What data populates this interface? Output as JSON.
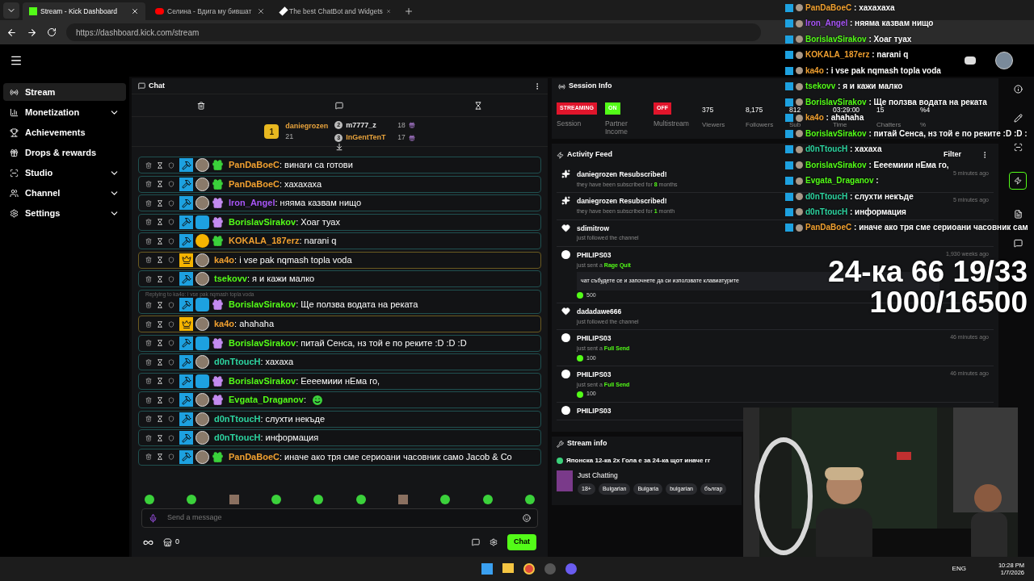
{
  "browser": {
    "tabs": [
      {
        "label": "Stream - Kick Dashboard",
        "selected": true,
        "kind": "kick"
      },
      {
        "label": "Селина - Вдига му бившат",
        "selected": false,
        "kind": "video"
      },
      {
        "label": "The best ChatBot and Widgets",
        "selected": false,
        "kind": "bot"
      }
    ],
    "url": "https://dashboard.kick.com/stream"
  },
  "sidebar": {
    "items": [
      {
        "label": "Stream",
        "selected": true,
        "expandable": false
      },
      {
        "label": "Monetization",
        "selected": false,
        "expandable": true
      },
      {
        "label": "Achievements",
        "selected": false,
        "expandable": false
      },
      {
        "label": "Drops & rewards",
        "selected": false,
        "expandable": false
      },
      {
        "label": "Studio",
        "selected": false,
        "expandable": true
      },
      {
        "label": "Channel",
        "selected": false,
        "expandable": true
      },
      {
        "label": "Settings",
        "selected": false,
        "expandable": true
      }
    ]
  },
  "chat": {
    "title": "Chat",
    "leaders": [
      {
        "rank": "1",
        "name": "daniegrozen",
        "count": "21",
        "color": "#e8a33c"
      },
      {
        "rank": "2",
        "name": "m7777_z",
        "count": "18",
        "color": "#e5e5e5"
      },
      {
        "rank": "3",
        "name": "InGentTenT",
        "count": "17",
        "color": "#e8a33c"
      }
    ],
    "messages": [
      {
        "user": "PanDaBoeC",
        "color": "#f0a030",
        "text": ": винаги са готови",
        "kind": "gifter",
        "highlight": false
      },
      {
        "user": "PanDaBoeC",
        "color": "#f0a030",
        "text": ": хахахаха",
        "kind": "gifter",
        "highlight": false
      },
      {
        "user": "Iron_Angel",
        "color": "#a855f7",
        "text": ": няяма казвам нищо",
        "kind": "purple",
        "highlight": false
      },
      {
        "user": "BorislavSirakov",
        "color": "#53fc18",
        "text": ": Хоаг туах",
        "kind": "og",
        "highlight": false
      },
      {
        "user": "KOKALA_187erz",
        "color": "#f0a030",
        "text": ": narani q",
        "kind": "rank",
        "highlight": false
      },
      {
        "user": "ka4o",
        "color": "#f0a030",
        "text": ": i vse pak nqmash topla voda",
        "kind": "vip",
        "highlight": true
      },
      {
        "user": "tsekovv",
        "color": "#53fc18",
        "text": ": я и кажи малко",
        "kind": "mod",
        "highlight": false
      },
      {
        "user": "BorislavSirakov",
        "color": "#53fc18",
        "text": ": Ще ползва водата на реката",
        "kind": "og",
        "highlight": false,
        "reply": "Replying to ka4o: i vse pak nqmash topla voda"
      },
      {
        "user": "ka4o",
        "color": "#f0a030",
        "text": ": ahahaha",
        "kind": "vip",
        "highlight": true
      },
      {
        "user": "BorislavSirakov",
        "color": "#53fc18",
        "text": ": питай Сенса, нз той е по реките :D :D :D",
        "kind": "og",
        "highlight": false
      },
      {
        "user": "d0nTtoucH",
        "color": "#2dd4a0",
        "text": ": хахаха",
        "kind": "mod",
        "highlight": false
      },
      {
        "user": "BorislavSirakov",
        "color": "#53fc18",
        "text": ": Еееемиии нЕма го,",
        "kind": "og",
        "highlight": false
      },
      {
        "user": "Evgata_Draganov",
        "color": "#53fc18",
        "text": ":",
        "kind": "purple",
        "highlight": false,
        "emote": true
      },
      {
        "user": "d0nTtoucH",
        "color": "#2dd4a0",
        "text": ": слухти некъде",
        "kind": "mod",
        "highlight": false
      },
      {
        "user": "d0nTtoucH",
        "color": "#2dd4a0",
        "text": ": информация",
        "kind": "mod",
        "highlight": false
      },
      {
        "user": "PanDaBoeC",
        "color": "#f0a030",
        "text": ": иначе ако тря сме сериоани часовник само Jacob & Co",
        "kind": "gifter",
        "highlight": false
      }
    ],
    "input": {
      "placeholder": "Send a message"
    },
    "points": "0",
    "send_label": "Chat"
  },
  "session": {
    "title": "Session Info",
    "badges": [
      {
        "value": "STREAMING",
        "label": "Session",
        "kind": "status"
      },
      {
        "value": "ON",
        "label": "Partner Income",
        "on": true,
        "kind": "toggle"
      },
      {
        "value": "OFF",
        "label": "Multistream",
        "on": false,
        "kind": "toggle"
      }
    ],
    "stats": [
      {
        "value": "375",
        "label": "Viewers"
      },
      {
        "value": "8,175",
        "label": "Followers"
      },
      {
        "value": "812",
        "label": "Sub"
      },
      {
        "value": "03:29:00",
        "label": "Time"
      },
      {
        "value": "15",
        "label": "Chatters"
      },
      {
        "value": "%4",
        "label": "%"
      }
    ]
  },
  "activity": {
    "title": "Activity Feed",
    "filter": "Filter",
    "items": [
      {
        "kind": "resub",
        "name": "daniegrozen Resubscribed!",
        "pre": "they have been subscribed for ",
        "hl": "8",
        "post": " months",
        "time": "5 minutes ago"
      },
      {
        "kind": "resub",
        "name": "daniegrozen Resubscribed!",
        "pre": "they have been subscribed for ",
        "hl": "1",
        "post": " month",
        "time": "5 minutes ago"
      },
      {
        "kind": "follow",
        "name": "sdimitrow",
        "pre": "just followed the channel"
      },
      {
        "kind": "gift",
        "name": "PHILIPS03",
        "pre": "just sent a ",
        "hl": "Rage Quit",
        "time": "1,930 weeks ago",
        "message": "чат събудете се и започнете да си използвате клавиатурите",
        "amount": "500"
      },
      {
        "kind": "follow",
        "name": "dadadawe666",
        "pre": "just followed the channel"
      },
      {
        "kind": "gift",
        "name": "PHILIPS03",
        "pre": "just sent a ",
        "hl": "Full Send",
        "time": "46 minutes ago",
        "amount": "100"
      },
      {
        "kind": "gift",
        "name": "PHILIPS03",
        "pre": "just sent a ",
        "hl": "Full Send",
        "time": "46 minutes ago",
        "amount": "100"
      },
      {
        "kind": "gift",
        "name": "PHILIPS03"
      }
    ]
  },
  "stream_info": {
    "title": "Stream info",
    "stream_title": "Японска 12-ка 2х Гола е за 24-ка щот иначе гг",
    "category": "Just Chatting",
    "tags": [
      "18+",
      "Bulgarian",
      "Bulgaria",
      "bulgarian",
      "българ"
    ]
  },
  "overlay": {
    "lines": [
      "24-ка 66 19/33",
      "1000/16500"
    ],
    "chat": [
      {
        "user": "PanDaBoeC",
        "color": "#f0a030",
        "text": ": хахахаха"
      },
      {
        "user": "Iron_Angel",
        "color": "#a855f7",
        "text": ": няяма казвам нищо"
      },
      {
        "user": "BorislavSirakov",
        "color": "#53fc18",
        "text": ": Хоаг туах"
      },
      {
        "user": "KOKALA_187erz",
        "color": "#f0a030",
        "text": ": narani q"
      },
      {
        "user": "ka4o",
        "color": "#f0a030",
        "text": ": i vse pak nqmash topla voda"
      },
      {
        "user": "tsekovv",
        "color": "#53fc18",
        "text": ": я и кажи малко"
      },
      {
        "user": "BorislavSirakov",
        "color": "#53fc18",
        "text": ": Ще ползва водата на реката"
      },
      {
        "user": "ka4o",
        "color": "#f0a030",
        "text": ": ahahaha"
      },
      {
        "user": "BorislavSirakov",
        "color": "#53fc18",
        "text": ": питай Сенса, нз той е по реките :D :D :"
      },
      {
        "user": "d0nTtoucH",
        "color": "#2dd4a0",
        "text": ": хахаха"
      },
      {
        "user": "BorislavSirakov",
        "color": "#53fc18",
        "text": ": Еееемиии нЕма го,"
      },
      {
        "user": "Evgata_Draganov",
        "color": "#53fc18",
        "text": ":"
      },
      {
        "user": "d0nTtoucH",
        "color": "#2dd4a0",
        "text": ": слухти некъде"
      },
      {
        "user": "d0nTtoucH",
        "color": "#2dd4a0",
        "text": ": информация"
      },
      {
        "user": "PanDaBoeC",
        "color": "#f0a030",
        "text": ": иначе ако тря сме сериоани часовник сам"
      }
    ]
  },
  "taskbar": {
    "lang": "ENG",
    "time": "10:28 PM",
    "date": "1/7/2026"
  }
}
